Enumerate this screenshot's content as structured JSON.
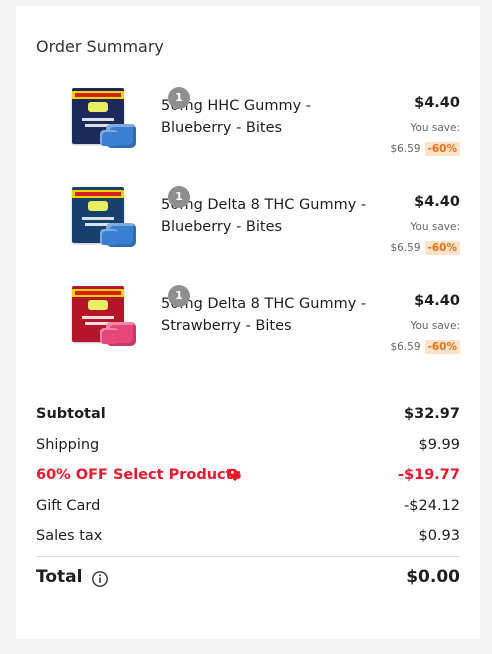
{
  "summary": {
    "title": "Order Summary",
    "items": [
      {
        "qty": "1",
        "name": "50mg HHC Gummy - Blueberry - Bites",
        "price": "$4.40",
        "you_save_label": "You save:",
        "original_price": "$6.59",
        "discount": "-60%",
        "pkg_color": "#1b2a5a",
        "gummy_color": "#3b7fd1"
      },
      {
        "qty": "1",
        "name": "50mg Delta 8 THC Gummy - Blueberry - Bites",
        "price": "$4.40",
        "you_save_label": "You save:",
        "original_price": "$6.59",
        "discount": "-60%",
        "pkg_color": "#16406e",
        "gummy_color": "#3a80d0"
      },
      {
        "qty": "1",
        "name": "50mg Delta 8 THC Gummy - Strawberry - Bites",
        "price": "$4.40",
        "you_save_label": "You save:",
        "original_price": "$6.59",
        "discount": "-60%",
        "pkg_color": "#b5152b",
        "gummy_color": "#e8457a"
      }
    ],
    "subtotal": {
      "label": "Subtotal",
      "value": "$32.97"
    },
    "shipping": {
      "label": "Shipping",
      "value": "$9.99"
    },
    "discount": {
      "label": "60% OFF Select Products",
      "value": "-$19.77"
    },
    "gift_card": {
      "label": "Gift Card",
      "value": "-$24.12"
    },
    "sales_tax": {
      "label": "Sales tax",
      "value": "$0.93"
    },
    "total": {
      "label": "Total",
      "value": "$0.00"
    }
  },
  "colors": {
    "discount_red": "#e8192c",
    "badge_orange": "#e8731a",
    "badge_bg": "#fde1c8"
  }
}
